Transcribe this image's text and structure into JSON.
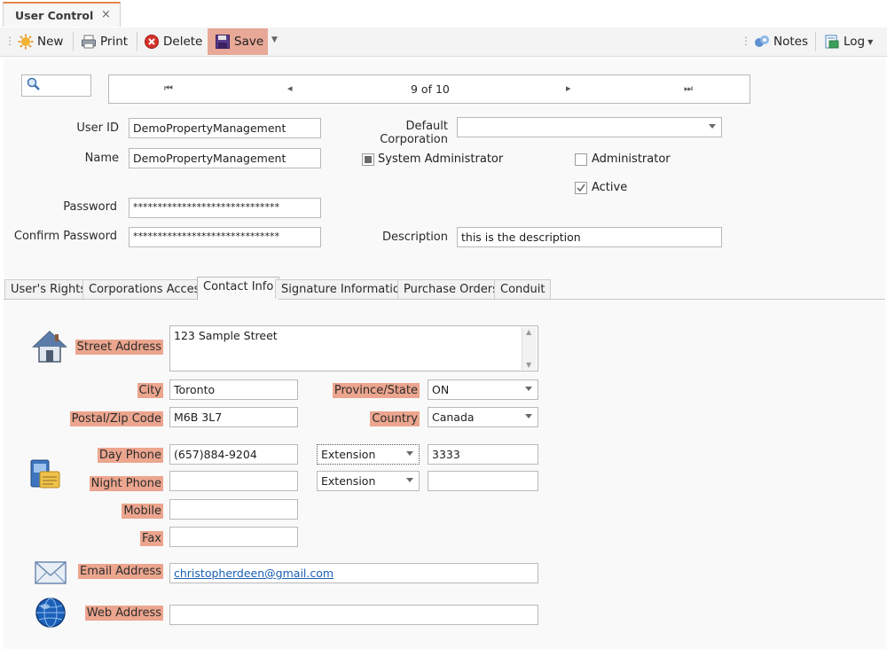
{
  "doc_tab": {
    "title": "User Control",
    "close": "×"
  },
  "toolbar": {
    "new_label": "New",
    "print_label": "Print",
    "delete_label": "Delete",
    "save_label": "Save",
    "notes_label": "Notes",
    "log_label": "Log"
  },
  "navigator": {
    "position": "9 of 10",
    "first": "⏮",
    "prev": "◂",
    "next": "▸",
    "last": "⏭"
  },
  "user": {
    "user_id_label": "User ID",
    "user_id": "DemoPropertyManagement",
    "name_label": "Name",
    "name": "DemoPropertyManagement",
    "password_label": "Password",
    "password": "******************************",
    "confirm_label": "Confirm Password",
    "confirm": "******************************",
    "default_corp_label": "Default Corporation",
    "default_corp": "",
    "sysadmin_label": "System Administrator",
    "admin_label": "Administrator",
    "active_label": "Active",
    "active": true,
    "description_label": "Description",
    "description": "this is the description"
  },
  "tabs": [
    "User's Rights",
    "Corporations Access",
    "Contact Info",
    "Signature Information",
    "Purchase Orders",
    "Conduit"
  ],
  "active_tab": "Contact Info",
  "contact": {
    "street_label": "Street Address",
    "street": "123 Sample Street",
    "city_label": "City",
    "city": "Toronto",
    "province_label": "Province/State",
    "province": "ON",
    "postal_label": "Postal/Zip Code",
    "postal": "M6B 3L7",
    "country_label": "Country",
    "country": "Canada",
    "day_phone_label": "Day Phone",
    "day_phone": "(657)884-9204",
    "day_ext_type": "Extension",
    "day_ext": "3333",
    "night_phone_label": "Night Phone",
    "night_phone": "",
    "night_ext_type": "Extension",
    "night_ext": "",
    "mobile_label": "Mobile",
    "mobile": "",
    "fax_label": "Fax",
    "fax": "",
    "email_label": "Email Address",
    "email": "christopherdeen@gmail.com",
    "web_label": "Web Address",
    "web": ""
  },
  "colors": {
    "highlight": "#eca58e",
    "accent": "#e8864a",
    "link": "#1a5fb4"
  }
}
